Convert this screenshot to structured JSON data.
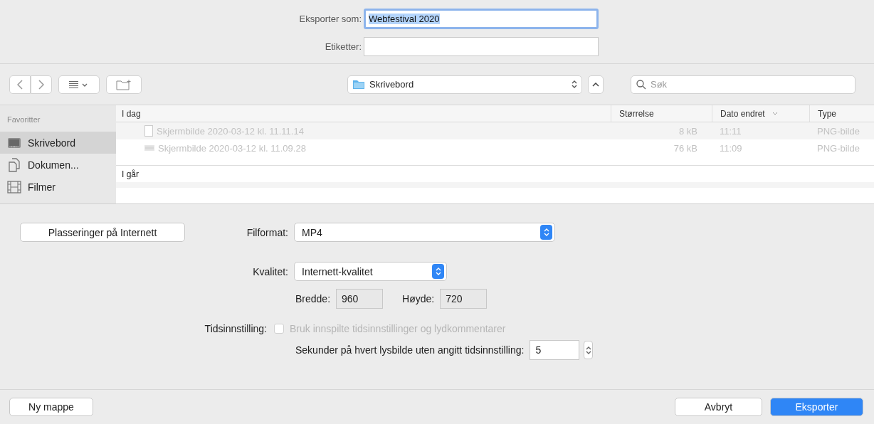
{
  "header": {
    "fields": [
      {
        "label": "Eksporter som:",
        "value": "Webfestival 2020",
        "focused": true
      },
      {
        "label": "Etiketter:",
        "focused": false
      }
    ]
  },
  "toolbar": {
    "location": "Skrivebord",
    "search": {
      "placeholder": "Søk"
    }
  },
  "sidebar": {
    "title": "Favoritter",
    "items": [
      {
        "label": "Skrivebord",
        "selected": true
      },
      {
        "label": "Dokumen...",
        "selected": false
      },
      {
        "label": "Filmer",
        "selected": false
      }
    ]
  },
  "file_list": {
    "columns": [
      {
        "label": "Størrelse",
        "sorted": false
      },
      {
        "label": "Dato endret",
        "sorted": true
      },
      {
        "label": "Type",
        "sorted": false
      }
    ],
    "groups": [
      {
        "title": "I dag",
        "rows": [
          {
            "name": "Skjermbilde 2020-03-12 kl. 11.11.14",
            "size": "8 kB",
            "date": "11:11",
            "type": "PNG-bilde",
            "disabled": true
          },
          {
            "name": "Skjermbilde 2020-03-12 kl. 11.09.28",
            "size": "76 kB",
            "date": "11:09",
            "type": "PNG-bilde",
            "disabled": true
          }
        ]
      },
      {
        "title": "I går"
      }
    ]
  },
  "options": {
    "internet_button": "Plasseringer på Internett",
    "file_format": {
      "label": "Filformat:",
      "value": "MP4"
    },
    "quality": {
      "label": "Kvalitet:",
      "value": "Internett-kvalitet"
    },
    "width": {
      "label": "Bredde:",
      "value": "960"
    },
    "height": {
      "label": "Høyde:",
      "value": "720"
    },
    "timing": {
      "label": "Tidsinnstilling:",
      "checkbox": "Bruk innspilte tidsinnstillinger og lydkommentarer",
      "checked": false,
      "disabled": true
    },
    "seconds": {
      "label": "Sekunder på hvert lysbilde uten angitt tidsinnstilling:",
      "value": "5"
    }
  },
  "footer": {
    "new_folder": "Ny mappe",
    "cancel": "Avbryt",
    "export": "Eksporter"
  }
}
